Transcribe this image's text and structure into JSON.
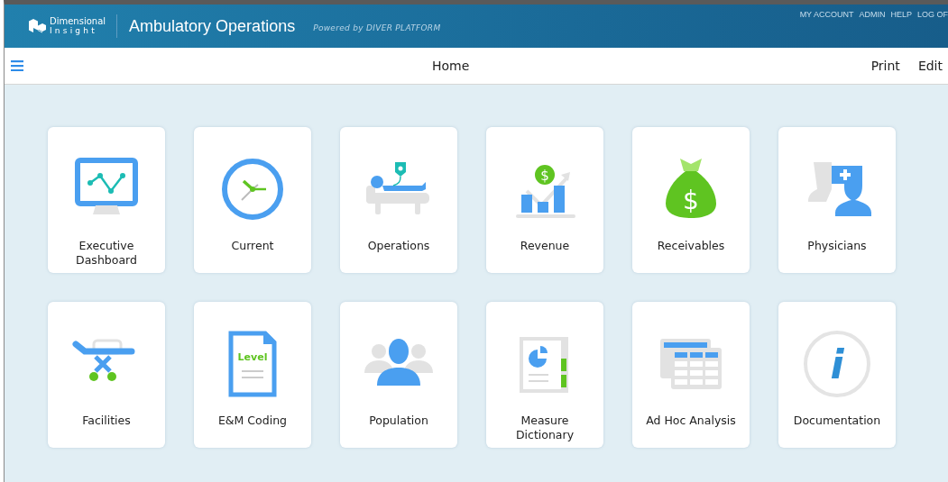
{
  "header": {
    "logo_lines": [
      "Dimensional",
      "Insight"
    ],
    "app_title": "Ambulatory Operations",
    "powered_by": "Powered by DIVER PLATFORM",
    "links": [
      "MY ACCOUNT",
      "ADMIN",
      "HELP",
      "LOG OF"
    ]
  },
  "toolbar": {
    "title": "Home",
    "actions": [
      "Print",
      "Edit"
    ]
  },
  "tiles": [
    {
      "label": "Executive Dashboard"
    },
    {
      "label": "Current"
    },
    {
      "label": "Operations"
    },
    {
      "label": "Revenue",
      "icon_text": "$"
    },
    {
      "label": "Receivables",
      "icon_text": "$"
    },
    {
      "label": "Physicians"
    },
    {
      "label": "Facilities"
    },
    {
      "label": "E&M Coding",
      "icon_text": "Level"
    },
    {
      "label": "Population"
    },
    {
      "label": "Measure Dictionary"
    },
    {
      "label": "Ad Hoc Analysis"
    },
    {
      "label": "Documentation",
      "icon_text": "i"
    }
  ]
}
